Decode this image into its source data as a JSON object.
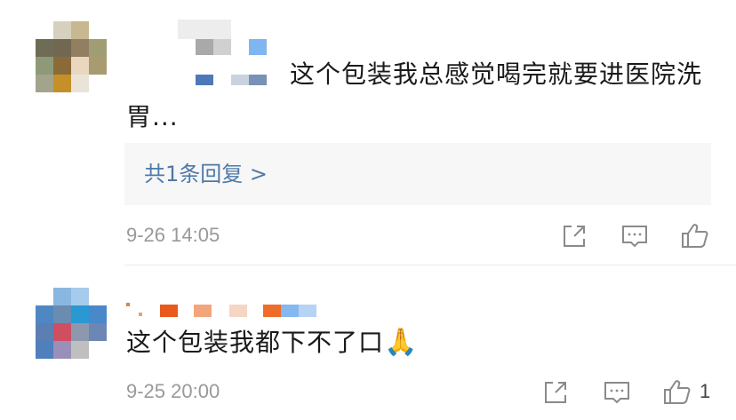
{
  "comments": [
    {
      "text": "这个包装我总感觉喝完就要进医院洗胃...",
      "reply_summary": "共1条回复 >",
      "time": "9-26 14:05",
      "like_count": ""
    },
    {
      "text": "这个包装我都下不了口",
      "emoji": "🙏",
      "time": "9-25 20:00",
      "like_count": "1"
    }
  ],
  "icons": {
    "share": "share-icon",
    "reply": "comment-icon",
    "like": "thumbs-up-icon"
  },
  "colors": {
    "link": "#4e79a7",
    "muted": "#999999",
    "reply_bg": "#f7f7f7"
  }
}
